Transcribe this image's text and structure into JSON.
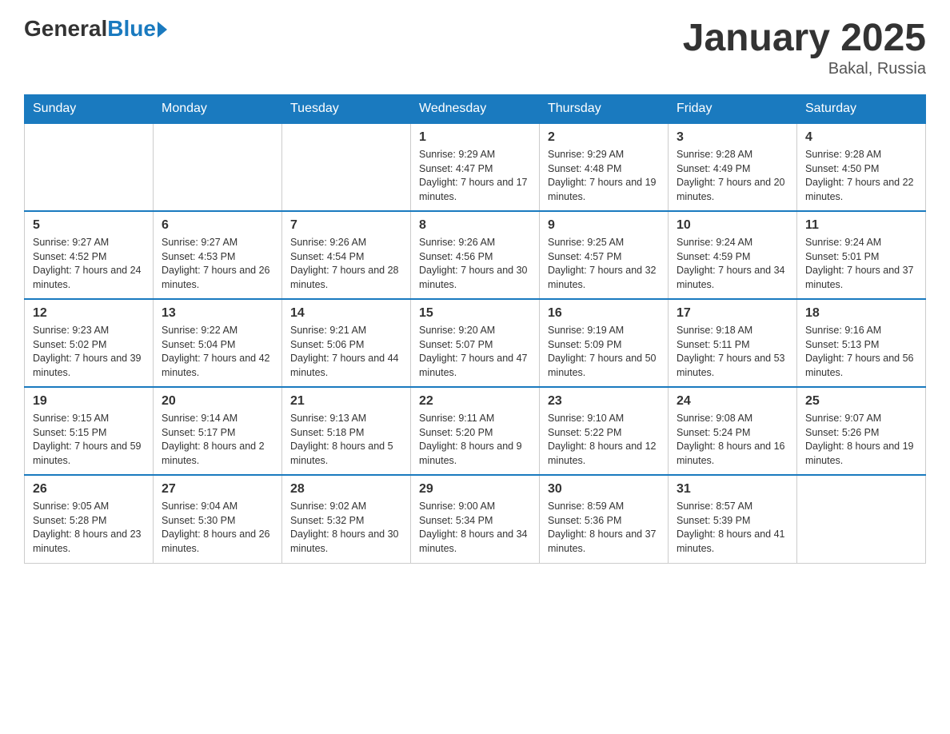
{
  "logo": {
    "general": "General",
    "blue": "Blue"
  },
  "title": "January 2025",
  "subtitle": "Bakal, Russia",
  "days_of_week": [
    "Sunday",
    "Monday",
    "Tuesday",
    "Wednesday",
    "Thursday",
    "Friday",
    "Saturday"
  ],
  "weeks": [
    [
      {
        "day": "",
        "info": ""
      },
      {
        "day": "",
        "info": ""
      },
      {
        "day": "",
        "info": ""
      },
      {
        "day": "1",
        "info": "Sunrise: 9:29 AM\nSunset: 4:47 PM\nDaylight: 7 hours\nand 17 minutes."
      },
      {
        "day": "2",
        "info": "Sunrise: 9:29 AM\nSunset: 4:48 PM\nDaylight: 7 hours\nand 19 minutes."
      },
      {
        "day": "3",
        "info": "Sunrise: 9:28 AM\nSunset: 4:49 PM\nDaylight: 7 hours\nand 20 minutes."
      },
      {
        "day": "4",
        "info": "Sunrise: 9:28 AM\nSunset: 4:50 PM\nDaylight: 7 hours\nand 22 minutes."
      }
    ],
    [
      {
        "day": "5",
        "info": "Sunrise: 9:27 AM\nSunset: 4:52 PM\nDaylight: 7 hours\nand 24 minutes."
      },
      {
        "day": "6",
        "info": "Sunrise: 9:27 AM\nSunset: 4:53 PM\nDaylight: 7 hours\nand 26 minutes."
      },
      {
        "day": "7",
        "info": "Sunrise: 9:26 AM\nSunset: 4:54 PM\nDaylight: 7 hours\nand 28 minutes."
      },
      {
        "day": "8",
        "info": "Sunrise: 9:26 AM\nSunset: 4:56 PM\nDaylight: 7 hours\nand 30 minutes."
      },
      {
        "day": "9",
        "info": "Sunrise: 9:25 AM\nSunset: 4:57 PM\nDaylight: 7 hours\nand 32 minutes."
      },
      {
        "day": "10",
        "info": "Sunrise: 9:24 AM\nSunset: 4:59 PM\nDaylight: 7 hours\nand 34 minutes."
      },
      {
        "day": "11",
        "info": "Sunrise: 9:24 AM\nSunset: 5:01 PM\nDaylight: 7 hours\nand 37 minutes."
      }
    ],
    [
      {
        "day": "12",
        "info": "Sunrise: 9:23 AM\nSunset: 5:02 PM\nDaylight: 7 hours\nand 39 minutes."
      },
      {
        "day": "13",
        "info": "Sunrise: 9:22 AM\nSunset: 5:04 PM\nDaylight: 7 hours\nand 42 minutes."
      },
      {
        "day": "14",
        "info": "Sunrise: 9:21 AM\nSunset: 5:06 PM\nDaylight: 7 hours\nand 44 minutes."
      },
      {
        "day": "15",
        "info": "Sunrise: 9:20 AM\nSunset: 5:07 PM\nDaylight: 7 hours\nand 47 minutes."
      },
      {
        "day": "16",
        "info": "Sunrise: 9:19 AM\nSunset: 5:09 PM\nDaylight: 7 hours\nand 50 minutes."
      },
      {
        "day": "17",
        "info": "Sunrise: 9:18 AM\nSunset: 5:11 PM\nDaylight: 7 hours\nand 53 minutes."
      },
      {
        "day": "18",
        "info": "Sunrise: 9:16 AM\nSunset: 5:13 PM\nDaylight: 7 hours\nand 56 minutes."
      }
    ],
    [
      {
        "day": "19",
        "info": "Sunrise: 9:15 AM\nSunset: 5:15 PM\nDaylight: 7 hours\nand 59 minutes."
      },
      {
        "day": "20",
        "info": "Sunrise: 9:14 AM\nSunset: 5:17 PM\nDaylight: 8 hours\nand 2 minutes."
      },
      {
        "day": "21",
        "info": "Sunrise: 9:13 AM\nSunset: 5:18 PM\nDaylight: 8 hours\nand 5 minutes."
      },
      {
        "day": "22",
        "info": "Sunrise: 9:11 AM\nSunset: 5:20 PM\nDaylight: 8 hours\nand 9 minutes."
      },
      {
        "day": "23",
        "info": "Sunrise: 9:10 AM\nSunset: 5:22 PM\nDaylight: 8 hours\nand 12 minutes."
      },
      {
        "day": "24",
        "info": "Sunrise: 9:08 AM\nSunset: 5:24 PM\nDaylight: 8 hours\nand 16 minutes."
      },
      {
        "day": "25",
        "info": "Sunrise: 9:07 AM\nSunset: 5:26 PM\nDaylight: 8 hours\nand 19 minutes."
      }
    ],
    [
      {
        "day": "26",
        "info": "Sunrise: 9:05 AM\nSunset: 5:28 PM\nDaylight: 8 hours\nand 23 minutes."
      },
      {
        "day": "27",
        "info": "Sunrise: 9:04 AM\nSunset: 5:30 PM\nDaylight: 8 hours\nand 26 minutes."
      },
      {
        "day": "28",
        "info": "Sunrise: 9:02 AM\nSunset: 5:32 PM\nDaylight: 8 hours\nand 30 minutes."
      },
      {
        "day": "29",
        "info": "Sunrise: 9:00 AM\nSunset: 5:34 PM\nDaylight: 8 hours\nand 34 minutes."
      },
      {
        "day": "30",
        "info": "Sunrise: 8:59 AM\nSunset: 5:36 PM\nDaylight: 8 hours\nand 37 minutes."
      },
      {
        "day": "31",
        "info": "Sunrise: 8:57 AM\nSunset: 5:39 PM\nDaylight: 8 hours\nand 41 minutes."
      },
      {
        "day": "",
        "info": ""
      }
    ]
  ]
}
